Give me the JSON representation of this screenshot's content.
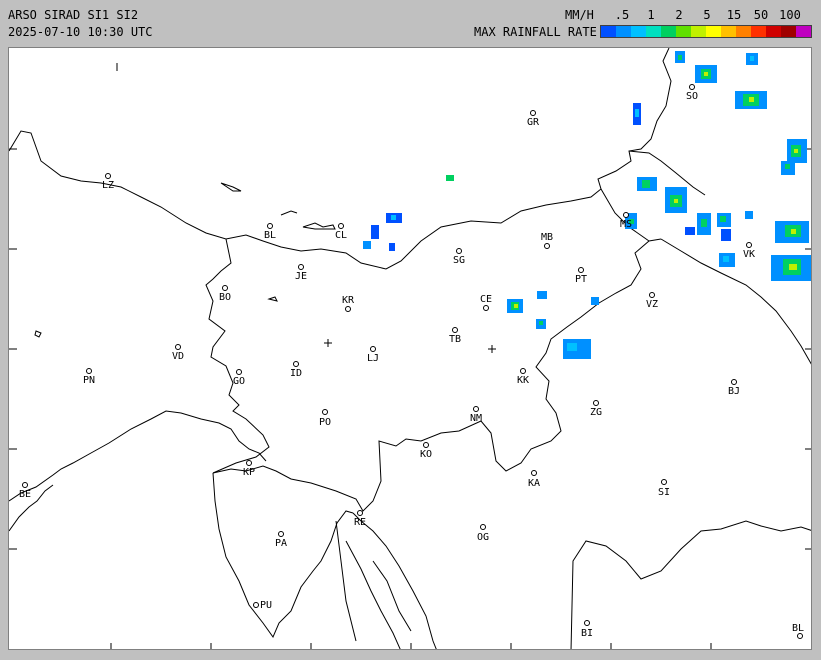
{
  "header": {
    "title": "ARSO SIRAD SI1 SI2",
    "timestamp": "2025-07-10 10:30 UTC",
    "unit": "MM/H",
    "legend_title": "MAX RAINFALL RATE"
  },
  "legend": {
    "ticks": [
      ".5",
      "1",
      "2",
      "5",
      "15",
      "50",
      "100"
    ],
    "colors": [
      "#0050ff",
      "#0090ff",
      "#00c0ff",
      "#00e0c0",
      "#00d060",
      "#60e000",
      "#c0f000",
      "#ffff00",
      "#ffc000",
      "#ff8000",
      "#ff3000",
      "#d00000",
      "#a00000",
      "#c000c0"
    ]
  },
  "map": {
    "cities": [
      {
        "code": "GR"
      },
      {
        "code": "LZ"
      },
      {
        "code": "BL"
      },
      {
        "code": "CL"
      },
      {
        "code": "SO"
      },
      {
        "code": "MB"
      },
      {
        "code": "MS"
      },
      {
        "code": "VK"
      },
      {
        "code": "SG"
      },
      {
        "code": "JE"
      },
      {
        "code": "BO"
      },
      {
        "code": "KR"
      },
      {
        "code": "CE"
      },
      {
        "code": "PT"
      },
      {
        "code": "VZ"
      },
      {
        "code": "TB"
      },
      {
        "code": "VD"
      },
      {
        "code": "LJ"
      },
      {
        "code": "PN"
      },
      {
        "code": "GO"
      },
      {
        "code": "ID"
      },
      {
        "code": "KK"
      },
      {
        "code": "BJ"
      },
      {
        "code": "ZG"
      },
      {
        "code": "PO"
      },
      {
        "code": "NM"
      },
      {
        "code": "KO"
      },
      {
        "code": "KP"
      },
      {
        "code": "BE"
      },
      {
        "code": "KA"
      },
      {
        "code": "SI"
      },
      {
        "code": "RE"
      },
      {
        "code": "PA"
      },
      {
        "code": "OG"
      },
      {
        "code": "PU"
      },
      {
        "code": "BI"
      },
      {
        "code": "BL"
      }
    ]
  }
}
